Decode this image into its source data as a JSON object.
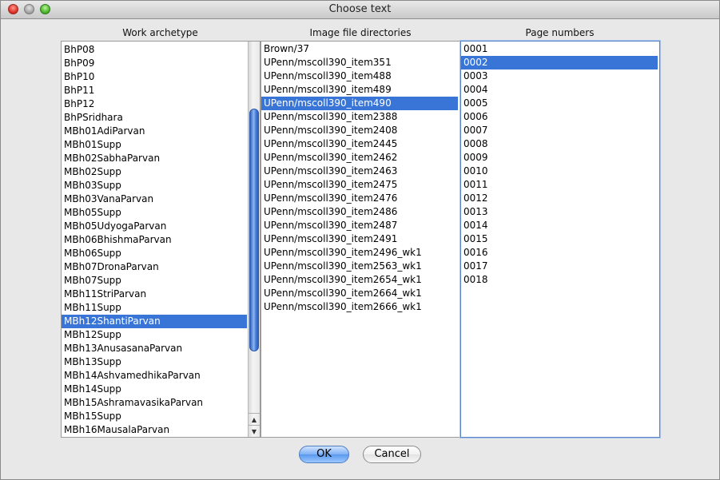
{
  "window": {
    "title": "Choose text"
  },
  "columns": {
    "work": {
      "header": "Work archetype",
      "items": [
        "BhP08",
        "BhP09",
        "BhP10",
        "BhP11",
        "BhP12",
        "BhPSridhara",
        "MBh01AdiParvan",
        "MBh01Supp",
        "MBh02SabhaParvan",
        "MBh02Supp",
        "MBh03Supp",
        "MBh03VanaParvan",
        "MBh05Supp",
        "MBh05UdyogaParvan",
        "MBh06BhishmaParvan",
        "MBh06Supp",
        "MBh07DronaParvan",
        "MBh07Supp",
        "MBh11StriParvan",
        "MBh11Supp",
        "MBh12ShantiParvan",
        "MBh12Supp",
        "MBh13AnusasanaParvan",
        "MBh13Supp",
        "MBh14AshvamedhikaParvan",
        "MBh14Supp",
        "MBh15AshramavasikaParvan",
        "MBh15Supp",
        "MBh16MausalaParvan"
      ],
      "selected_index": 20
    },
    "dirs": {
      "header": "Image file directories",
      "items": [
        "Brown/37",
        "UPenn/mscoll390_item351",
        "UPenn/mscoll390_item488",
        "UPenn/mscoll390_item489",
        "UPenn/mscoll390_item490",
        "UPenn/mscoll390_item2388",
        "UPenn/mscoll390_item2408",
        "UPenn/mscoll390_item2445",
        "UPenn/mscoll390_item2462",
        "UPenn/mscoll390_item2463",
        "UPenn/mscoll390_item2475",
        "UPenn/mscoll390_item2476",
        "UPenn/mscoll390_item2486",
        "UPenn/mscoll390_item2487",
        "UPenn/mscoll390_item2491",
        "UPenn/mscoll390_item2496_wk1",
        "UPenn/mscoll390_item2563_wk1",
        "UPenn/mscoll390_item2654_wk1",
        "UPenn/mscoll390_item2664_wk1",
        "UPenn/mscoll390_item2666_wk1"
      ],
      "selected_index": 4
    },
    "pages": {
      "header": "Page numbers",
      "items": [
        "0001",
        "0002",
        "0003",
        "0004",
        "0005",
        "0006",
        "0007",
        "0008",
        "0009",
        "0010",
        "0011",
        "0012",
        "0013",
        "0014",
        "0015",
        "0016",
        "0017",
        "0018"
      ],
      "selected_index": 1
    }
  },
  "buttons": {
    "ok_label": "OK",
    "cancel_label": "Cancel"
  },
  "icons": {
    "scroll_up": "up-arrow-icon",
    "scroll_down": "down-arrow-icon"
  },
  "colors": {
    "selection": "#3875d7",
    "focus_ring": "#5a86c8"
  }
}
